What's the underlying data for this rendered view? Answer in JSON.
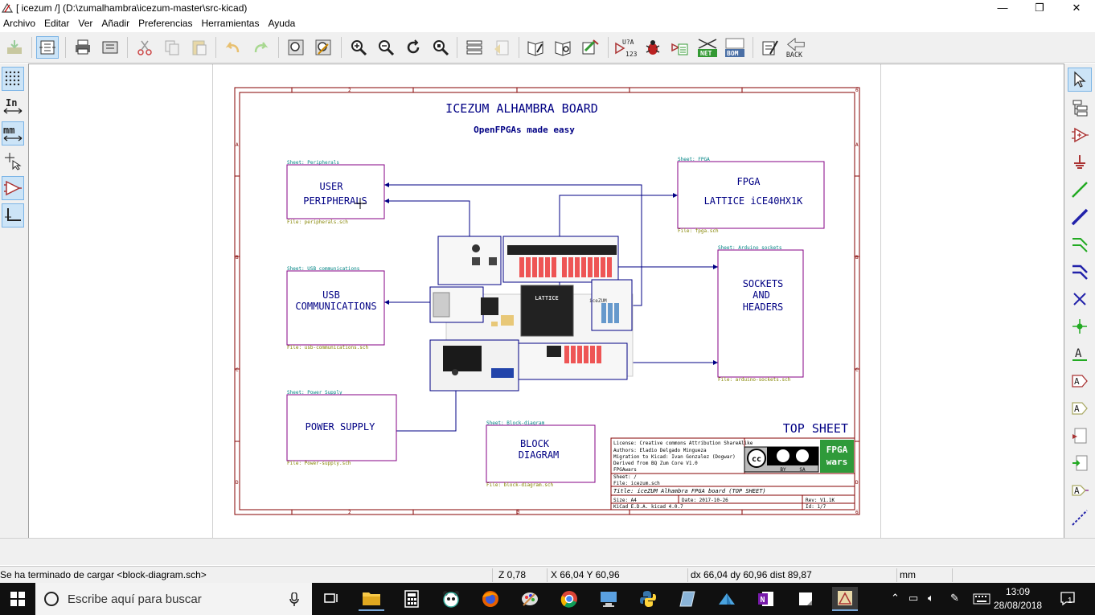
{
  "window": {
    "title": "[ icezum /] (D:\\zumalhambra\\icezum-master\\src-kicad)",
    "minimize_glyph": "—",
    "maximize_glyph": "❐",
    "close_glyph": "✕"
  },
  "menu": [
    "Archivo",
    "Editar",
    "Ver",
    "Añadir",
    "Preferencias",
    "Herramientas",
    "Ayuda"
  ],
  "toolbar": {
    "icons": [
      "load-icon",
      "hierarchy-navigator-icon",
      "print-icon",
      "plot-icon",
      "cut-icon",
      "copy-icon",
      "paste-icon",
      "undo-icon",
      "redo-icon",
      "find-icon",
      "find-replace-icon",
      "zoom-in-icon",
      "zoom-out-icon",
      "redraw-icon",
      "zoom-fit-icon",
      "hierarchy-icon",
      "leave-sheet-icon",
      "library-editor-icon",
      "library-browser-icon",
      "annotate-icon",
      "erc-icon",
      "bug-icon",
      "footprint-assign-icon",
      "netlist-icon",
      "bom-icon",
      "pcbnew-icon",
      "back-annotate-icon"
    ],
    "annotate_label": "U?A",
    "annotate_sub": "123",
    "net_label": "NET",
    "bom_label": "BOM",
    "back_label": "BACK"
  },
  "left_toolbar": {
    "units_in": "In",
    "units_mm": "mm"
  },
  "right_toolbar": {
    "label_text": "A"
  },
  "schematic": {
    "title": "ICEZUM ALHAMBRA BOARD",
    "subtitle": "OpenFPGAs made easy",
    "top_sheet": "TOP SHEET",
    "sheets": {
      "peripherals": {
        "name_top": "Sheet: Peripherals",
        "file": "File: peripherals.sch",
        "line1": "USER",
        "line2": "PERIPHERALS"
      },
      "fpga": {
        "name_top": "Sheet: FPGA",
        "file": "File: fpga.sch",
        "line1": "FPGA",
        "line2": "LATTICE iCE40HX1K"
      },
      "usb": {
        "name_top": "Sheet: USB communications",
        "file": "File: usb-communications.sch",
        "line1": "USB",
        "line2": "COMMUNICATIONS"
      },
      "sockets": {
        "name_top": "Sheet: Arduino sockets",
        "file": "File: arduino-sockets.sch",
        "line1": "SOCKETS",
        "line2": "AND",
        "line3": "HEADERS"
      },
      "power": {
        "name_top": "Sheet: Power Supply",
        "file": "File: Power-supply.sch",
        "line1": "POWER SUPPLY"
      },
      "block": {
        "name_top": "Sheet: Block-diagram",
        "file": "File: block-diagram.sch",
        "line1": "BLOCK",
        "line2": "DIAGRAM"
      }
    },
    "board_chip": "LATTICE",
    "board_label": "iceZUM",
    "border_row_labels": [
      "A",
      "B",
      "C",
      "D"
    ],
    "border_col_labels": [
      "1",
      "2",
      "3",
      "4",
      "5",
      "6"
    ],
    "titleblock": {
      "license": "License: Creative commons Attribution ShareAlike",
      "authors": "Authors: Eladio Delgado Mingueza",
      "migration": "Migration to Kicad: Ivan Gonzalez (Dogwar)",
      "derived": "Derived from BQ Zum Core V1.0",
      "org": "FPGAwars",
      "sheet": "Sheet: /",
      "file": "File: icezum.sch",
      "title": "Title: iceZUM Alhambra FPGA board (TOP SHEET)",
      "size": "Size: A4",
      "date": "Date: 2017-10-26",
      "rev": "Rev: V1.1K",
      "kicad": "KiCad E.D.A.  kicad 4.0.7",
      "id": "Id: 1/7",
      "cc": "cc",
      "by": "BY",
      "sa": "SA",
      "logo_line1": "FPGA",
      "logo_line2": "wars"
    }
  },
  "statusbar": {
    "message": "Se ha terminado de cargar <block-diagram.sch>",
    "zoom": "Z 0,78",
    "coords": "X 66,04  Y 60,96",
    "delta": "dx 66,04  dy 60,96  dist 89,87",
    "units": "mm"
  },
  "taskbar": {
    "search_placeholder": "Escribe aquí para buscar",
    "time": "13:09",
    "date": "28/08/2018",
    "notifications": "1"
  },
  "colors": {
    "sheet_border": "#840000",
    "sheet_box": "#840084",
    "wire": "#000084",
    "text_blue": "#000084",
    "sheet_name": "#008484",
    "sheet_file": "#848400",
    "toolbar_bg": "#f0f0f0",
    "taskbar_bg": "#101010",
    "accent": "#7ab4e6"
  }
}
